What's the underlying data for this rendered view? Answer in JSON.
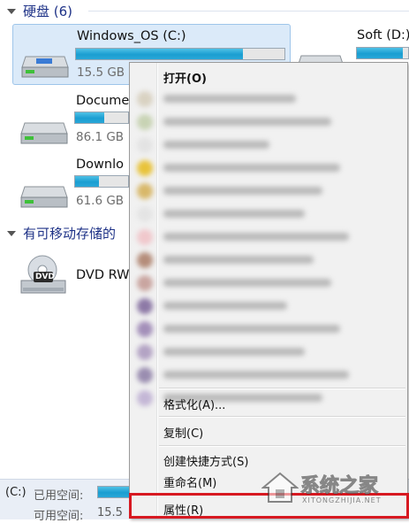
{
  "groups": {
    "hard_disks": "硬盘 (6)",
    "removable": "有可移动存储的"
  },
  "drives": [
    {
      "name": "Windows_OS (C:)",
      "size": "15.5 GB",
      "used_fraction": 0.8
    },
    {
      "name": "Soft (D:)",
      "used_fraction": 0.9
    },
    {
      "name": "Docume",
      "size": "86.1 GB",
      "used_fraction": 0.55
    },
    {
      "name": "Downlo",
      "size": "61.6 GB",
      "used_fraction": 0.45
    }
  ],
  "dvd": {
    "name": "DVD RW",
    "badge": "DVD"
  },
  "menu": {
    "open": "打开(O)",
    "format": "格式化(A)...",
    "copy": "复制(C)",
    "shortcut": "创建快捷方式(S)",
    "rename": "重命名(M)",
    "properties": "属性(R)"
  },
  "status": {
    "drive": "(C:)",
    "used_label": "已用空间:",
    "free_label": "可用空间:",
    "free_value": "15.5"
  },
  "watermark": {
    "title": "系统之家",
    "url": "XITONGZHIJIA.NET"
  },
  "colors": {
    "accent": "#1a9ed1",
    "highlight": "#d71921",
    "selection": "#dbeaf9"
  }
}
